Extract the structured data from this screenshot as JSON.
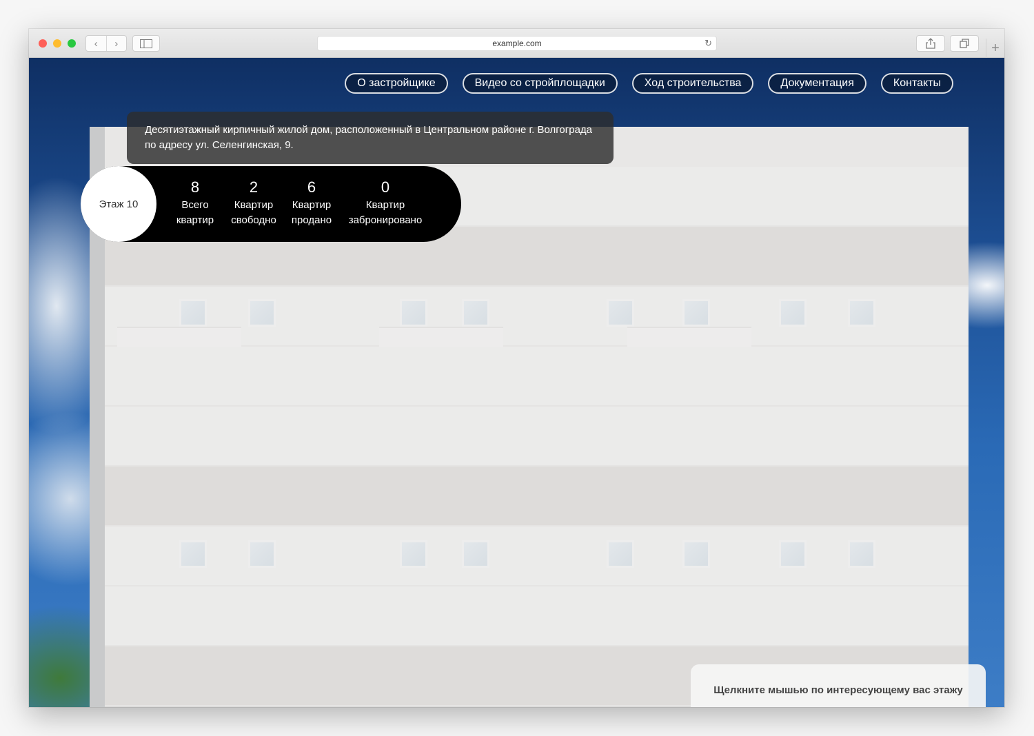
{
  "browser": {
    "url": "example.com",
    "back_icon": "chevron-left-icon",
    "forward_icon": "chevron-right-icon",
    "sidebar_icon": "sidebar-icon",
    "reload_icon": "reload-icon",
    "share_icon": "share-icon",
    "tabs_icon": "tabs-icon",
    "newtab_icon": "plus-icon"
  },
  "nav": {
    "items": [
      {
        "label": "О застройщике"
      },
      {
        "label": "Видео со стройплощадки"
      },
      {
        "label": "Ход строительства"
      },
      {
        "label": "Документация"
      },
      {
        "label": "Контакты"
      }
    ]
  },
  "description": "Десятиэтажный кирпичный жилой дом, расположенный в Центральном районе г. Волгограда по адресу ул. Селенгинская, 9.",
  "floor_info": {
    "floor_label": "Этаж 10",
    "stats": [
      {
        "value": "8",
        "label": "Всего\nквартир"
      },
      {
        "value": "2",
        "label": "Квартир\nсвободно"
      },
      {
        "value": "6",
        "label": "Квартир\nпродано"
      },
      {
        "value": "0",
        "label": "Квартир\nзабронировано"
      }
    ]
  },
  "hint": "Щелкните мышью по интересующему вас этажу",
  "colors": {
    "accent_dark": "#000000",
    "nav_border": "#ffffff",
    "sky": "#1d4f94"
  }
}
